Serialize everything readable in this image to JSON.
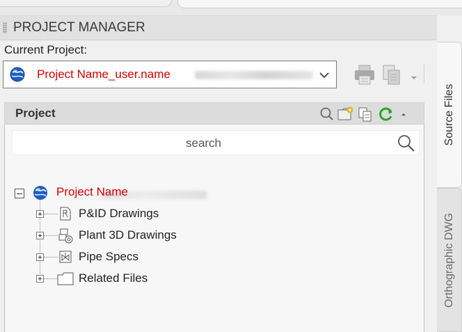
{
  "palette": {
    "title": "PROJECT MANAGER",
    "current_project_label": "Current Project:",
    "current_project_value": "Project Name_user.name"
  },
  "project_panel": {
    "header": "Project",
    "search_placeholder": "search",
    "root": {
      "name": "Project Name",
      "children": [
        {
          "label": "P&ID Drawings"
        },
        {
          "label": "Plant 3D Drawings"
        },
        {
          "label": "Pipe Specs"
        },
        {
          "label": "Related Files"
        }
      ]
    }
  },
  "side_tabs": [
    {
      "label": "Source Files",
      "active": true
    },
    {
      "label": "Orthographic DWG",
      "active": false
    }
  ],
  "colors": {
    "annotation_red": "#d40000",
    "globe_blue": "#1f5fbf",
    "refresh_green": "#2aa52a",
    "new_folder_gold": "#e7a91b"
  },
  "icons": {
    "globe": "globe-icon",
    "dropdown": "chevron-down-icon",
    "print": "print-icon",
    "copy": "copy-icon",
    "search": "search-icon",
    "new_folder": "new-folder-icon",
    "copy_files": "copy-files-icon",
    "refresh": "refresh-icon",
    "collapse": "caret-up-icon"
  }
}
